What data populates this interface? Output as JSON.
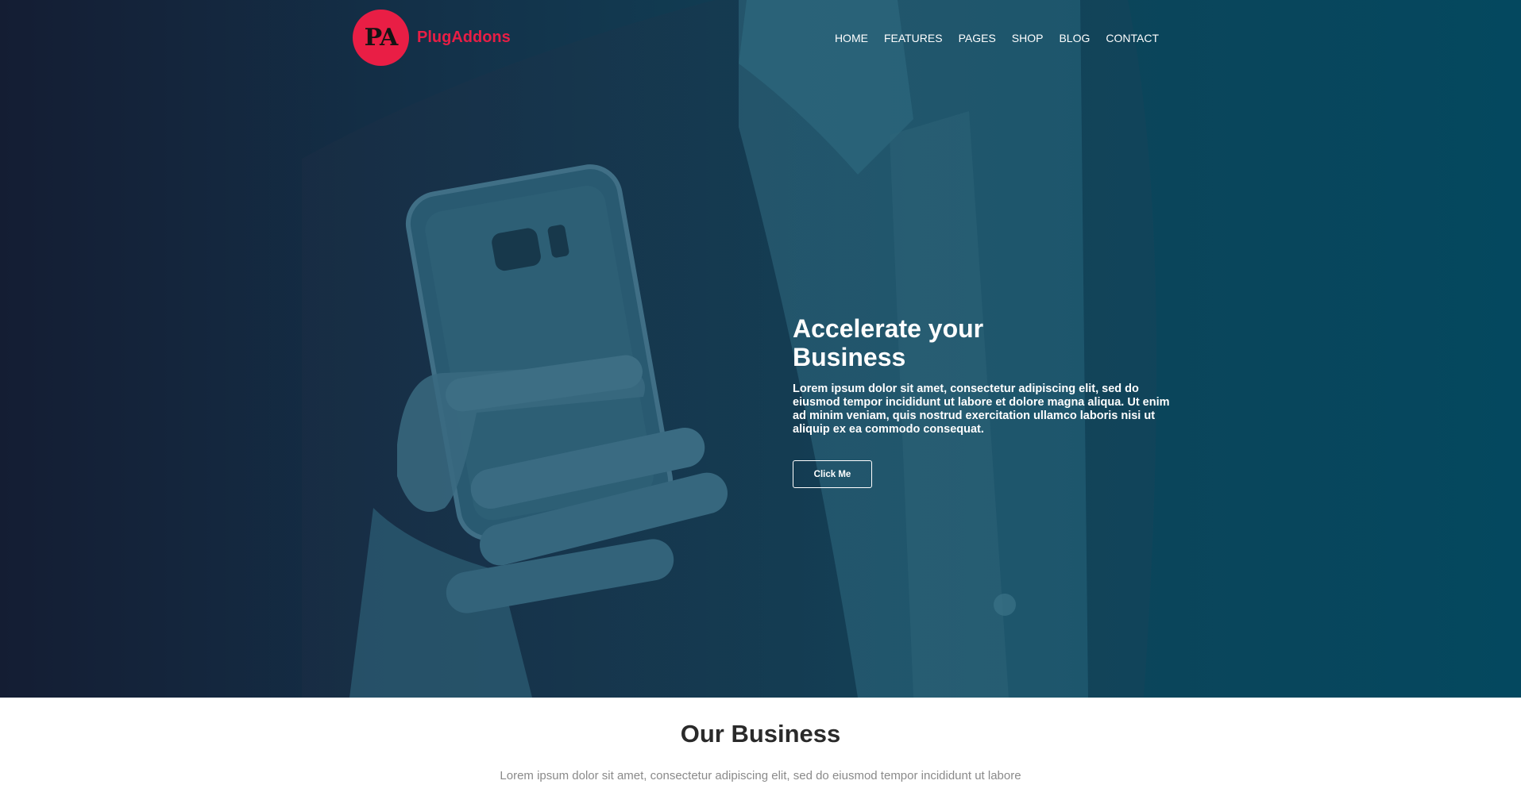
{
  "brand": {
    "logo_initials": "PA",
    "name": "PlugAddons",
    "color": "#e91e45"
  },
  "nav": {
    "items": [
      "HOME",
      "FEATURES",
      "PAGES",
      "SHOP",
      "BLOG",
      "CONTACT"
    ]
  },
  "hero": {
    "title": "Accelerate your Business",
    "text": "Lorem ipsum dolor sit amet, consectetur adipiscing elit, sed do eiusmod tempor incididunt ut labore et dolore magna aliqua. Ut enim ad minim veniam, quis nostrud exercitation ullamco laboris nisi ut aliquip ex ea commodo consequat.",
    "button_label": "Click Me"
  },
  "business": {
    "title": "Our Business",
    "text": "Lorem ipsum dolor sit amet, consectetur adipiscing elit, sed do eiusmod tempor incididunt ut labore"
  }
}
